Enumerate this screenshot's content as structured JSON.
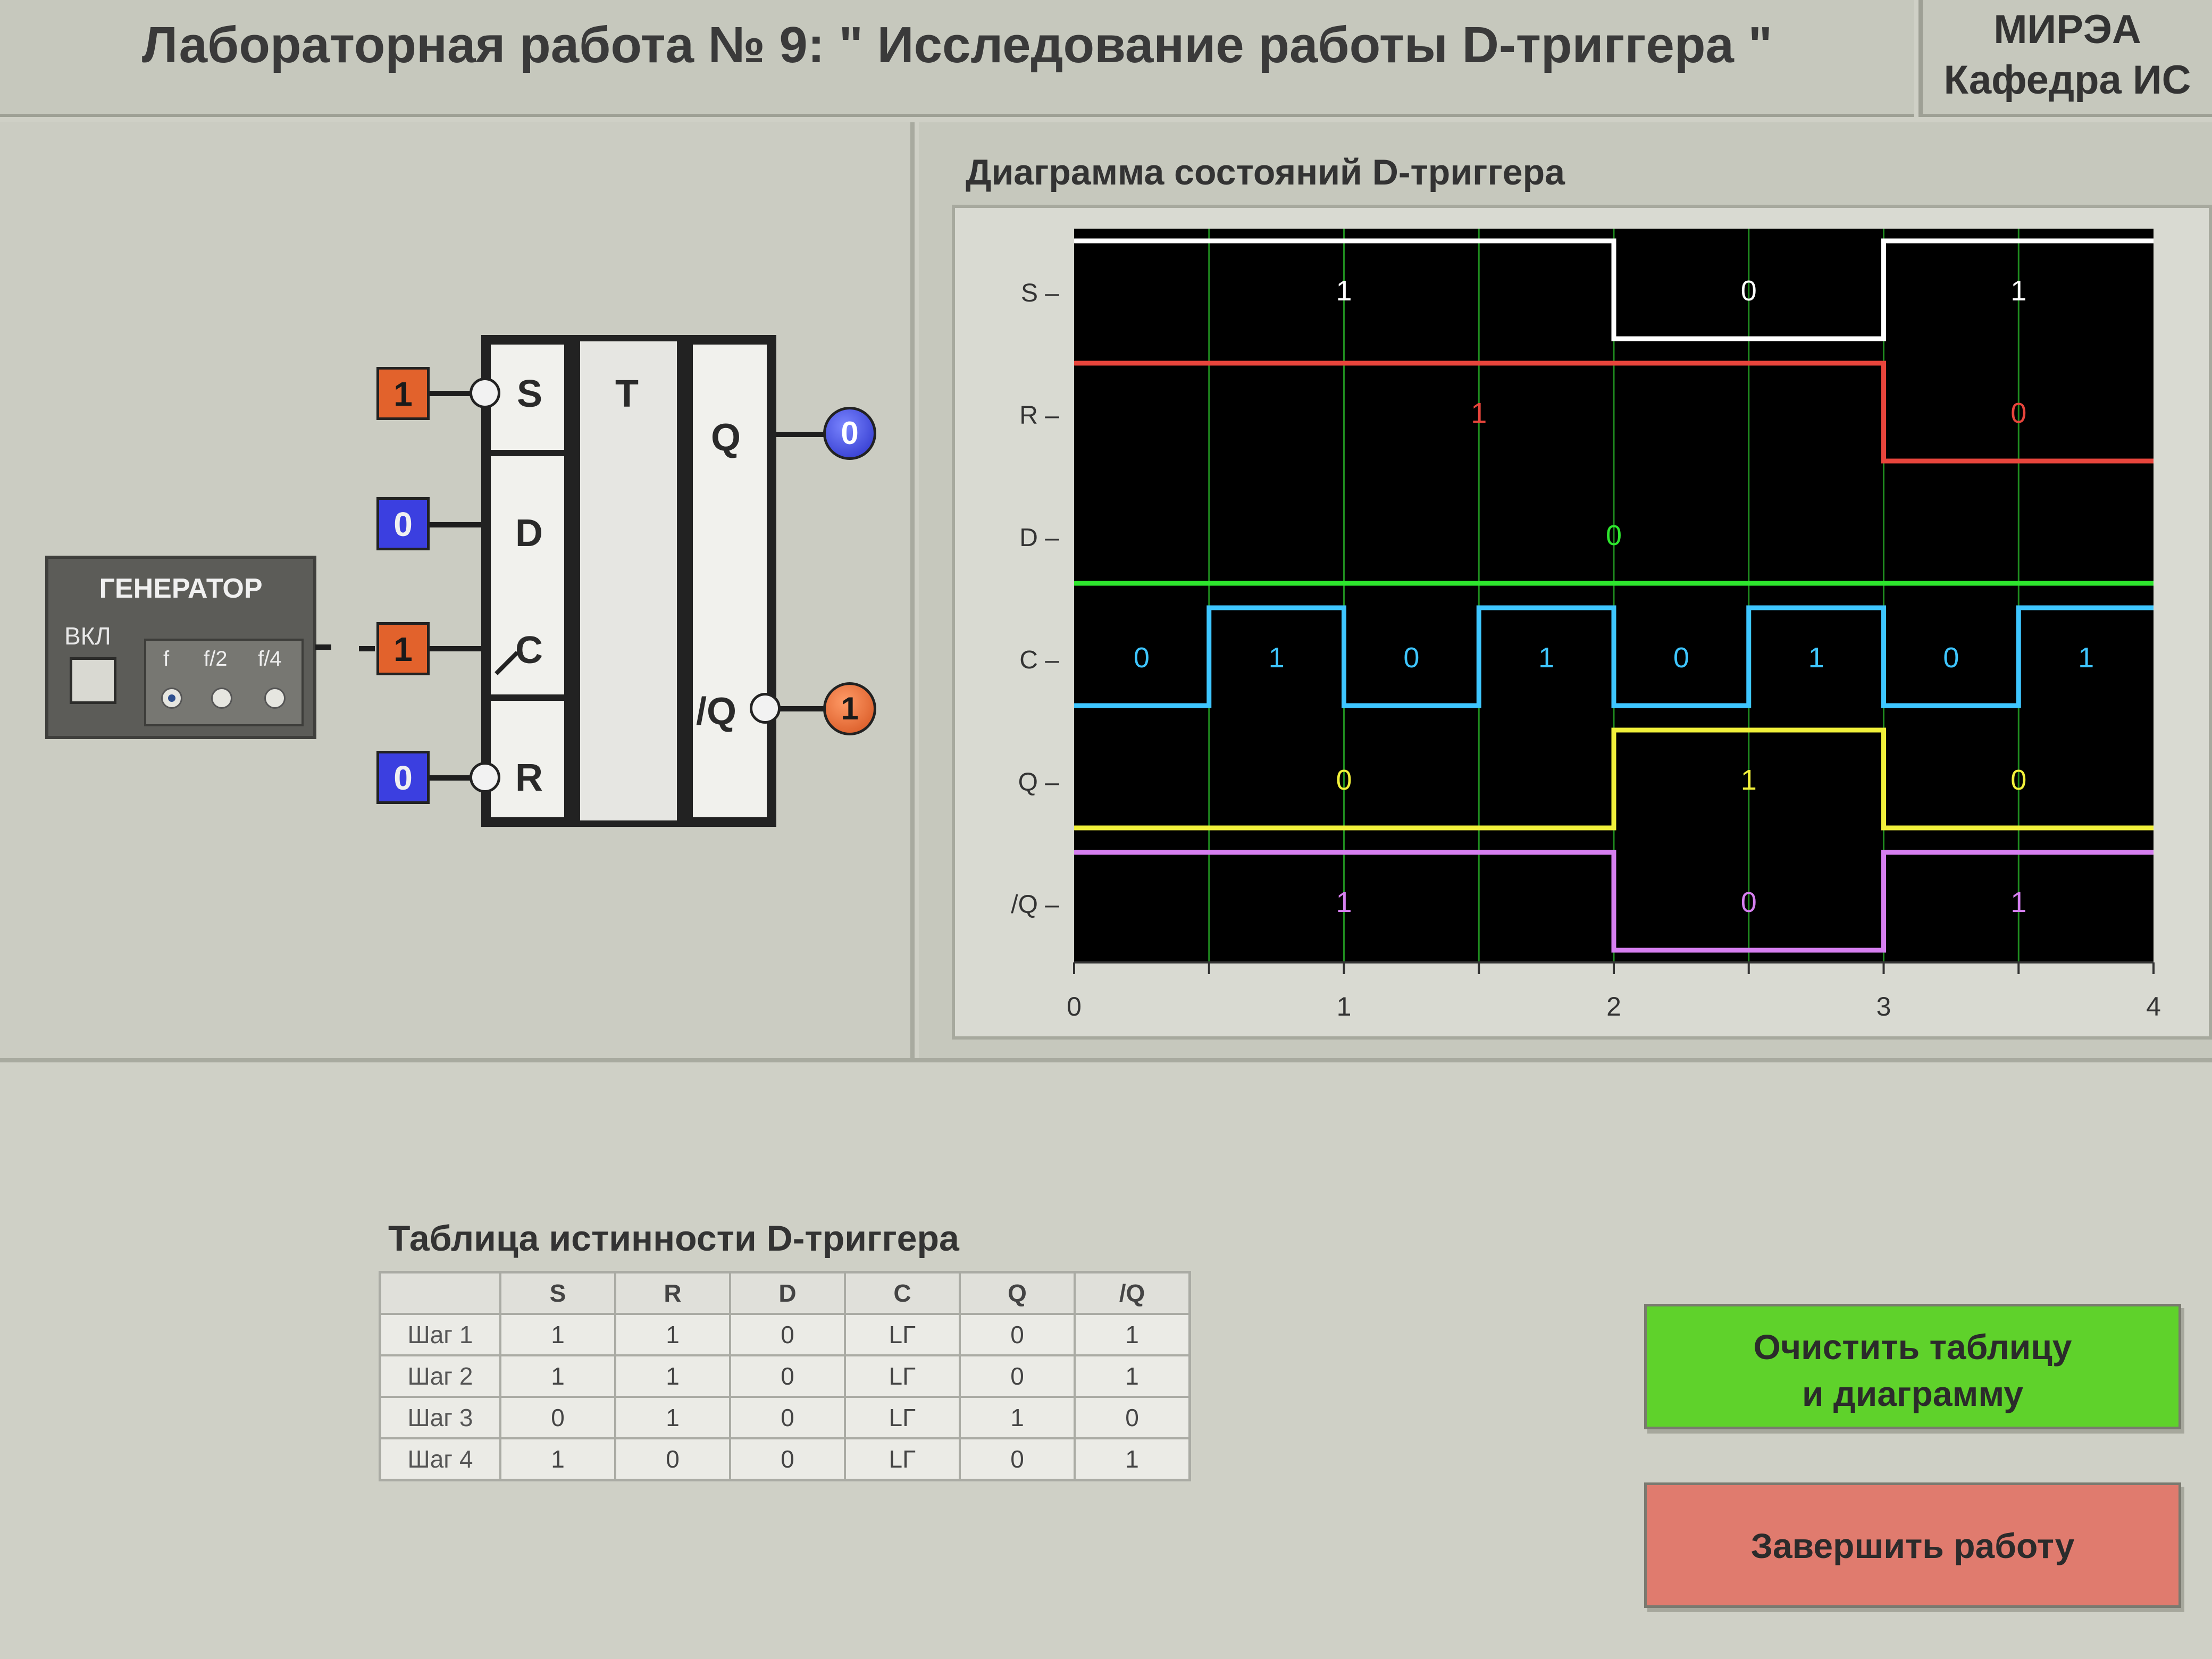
{
  "header": {
    "title": "Лабораторная работа № 9: \" Исследование работы D-триггера \"",
    "org_line1": "МИРЭА",
    "org_line2": "Кафедра ИС"
  },
  "generator": {
    "title": "ГЕНЕРАТОР",
    "on_label": "ВКЛ",
    "freq_options": [
      "f",
      "f/2",
      "f/4"
    ],
    "selected_freq": "f"
  },
  "trigger": {
    "type_label": "T",
    "inputs": {
      "S": {
        "label": "S",
        "value": "1"
      },
      "D": {
        "label": "D",
        "value": "0"
      },
      "C": {
        "label": "C",
        "value": "1"
      },
      "R": {
        "label": "R",
        "value": "0"
      }
    },
    "outputs": {
      "Q": {
        "label": "Q",
        "value": "0"
      },
      "NQ": {
        "label": "/Q",
        "value": "1"
      }
    }
  },
  "chart": {
    "title": "Диаграмма состояний D-триггера"
  },
  "chart_data": {
    "type": "line",
    "title": "Диаграмма состояний D-триггера",
    "x_ticks": [
      "0",
      "1",
      "2",
      "3",
      "4"
    ],
    "xlim": [
      0,
      4
    ],
    "background": "#000000",
    "grid": true,
    "series": [
      {
        "name": "S",
        "color": "#ffffff",
        "steps": [
          {
            "x0": 0,
            "x1": 2,
            "v": 1
          },
          {
            "x0": 2,
            "x1": 3,
            "v": 0
          },
          {
            "x0": 3,
            "x1": 4,
            "v": 1
          }
        ]
      },
      {
        "name": "R",
        "color": "#e8453c",
        "steps": [
          {
            "x0": 0,
            "x1": 3,
            "v": 1
          },
          {
            "x0": 3,
            "x1": 4,
            "v": 0
          }
        ]
      },
      {
        "name": "D",
        "color": "#2ee62e",
        "steps": [
          {
            "x0": 0,
            "x1": 4,
            "v": 0
          }
        ]
      },
      {
        "name": "C",
        "color": "#3ec6ff",
        "steps": [
          {
            "x0": 0,
            "x1": 0.5,
            "v": 0
          },
          {
            "x0": 0.5,
            "x1": 1,
            "v": 1
          },
          {
            "x0": 1,
            "x1": 1.5,
            "v": 0
          },
          {
            "x0": 1.5,
            "x1": 2,
            "v": 1
          },
          {
            "x0": 2,
            "x1": 2.5,
            "v": 0
          },
          {
            "x0": 2.5,
            "x1": 3,
            "v": 1
          },
          {
            "x0": 3,
            "x1": 3.5,
            "v": 0
          },
          {
            "x0": 3.5,
            "x1": 4,
            "v": 1
          }
        ]
      },
      {
        "name": "Q",
        "color": "#f1f03a",
        "steps": [
          {
            "x0": 0,
            "x1": 2,
            "v": 0
          },
          {
            "x0": 2,
            "x1": 3,
            "v": 1
          },
          {
            "x0": 3,
            "x1": 4,
            "v": 0
          }
        ]
      },
      {
        "name": "/Q",
        "color": "#d67ff0",
        "steps": [
          {
            "x0": 0,
            "x1": 2,
            "v": 1
          },
          {
            "x0": 2,
            "x1": 3,
            "v": 0
          },
          {
            "x0": 3,
            "x1": 4,
            "v": 1
          }
        ]
      }
    ],
    "value_labels": [
      {
        "series": "S",
        "x": 1,
        "text": "1"
      },
      {
        "series": "S",
        "x": 2.5,
        "text": "0"
      },
      {
        "series": "S",
        "x": 3.5,
        "text": "1"
      },
      {
        "series": "R",
        "x": 1.5,
        "text": "1"
      },
      {
        "series": "R",
        "x": 3.5,
        "text": "0"
      },
      {
        "series": "D",
        "x": 2,
        "text": "0"
      },
      {
        "series": "C",
        "x": 0.25,
        "text": "0"
      },
      {
        "series": "C",
        "x": 0.75,
        "text": "1"
      },
      {
        "series": "C",
        "x": 1.25,
        "text": "0"
      },
      {
        "series": "C",
        "x": 1.75,
        "text": "1"
      },
      {
        "series": "C",
        "x": 2.25,
        "text": "0"
      },
      {
        "series": "C",
        "x": 2.75,
        "text": "1"
      },
      {
        "series": "C",
        "x": 3.25,
        "text": "0"
      },
      {
        "series": "C",
        "x": 3.75,
        "text": "1"
      },
      {
        "series": "Q",
        "x": 1,
        "text": "0"
      },
      {
        "series": "Q",
        "x": 2.5,
        "text": "1"
      },
      {
        "series": "Q",
        "x": 3.5,
        "text": "0"
      },
      {
        "series": "/Q",
        "x": 1,
        "text": "1"
      },
      {
        "series": "/Q",
        "x": 2.5,
        "text": "0"
      },
      {
        "series": "/Q",
        "x": 3.5,
        "text": "1"
      }
    ]
  },
  "truth_table": {
    "title": "Таблица истинности D-триггера",
    "columns": [
      "",
      "S",
      "R",
      "D",
      "C",
      "Q",
      "/Q"
    ],
    "rows": [
      [
        "Шаг 1",
        "1",
        "1",
        "0",
        "LΓ",
        "0",
        "1"
      ],
      [
        "Шаг 2",
        "1",
        "1",
        "0",
        "LΓ",
        "0",
        "1"
      ],
      [
        "Шаг 3",
        "0",
        "1",
        "0",
        "LΓ",
        "1",
        "0"
      ],
      [
        "Шаг 4",
        "1",
        "0",
        "0",
        "LΓ",
        "0",
        "1"
      ]
    ]
  },
  "buttons": {
    "clear_line1": "Очистить таблицу",
    "clear_line2": "и диаграмму",
    "finish": "Завершить работу"
  },
  "colors": {
    "input_one": "#e2622c",
    "input_zero": "#3b3fe0",
    "clear_button": "#5fd22b",
    "finish_button": "#e07b6e"
  }
}
